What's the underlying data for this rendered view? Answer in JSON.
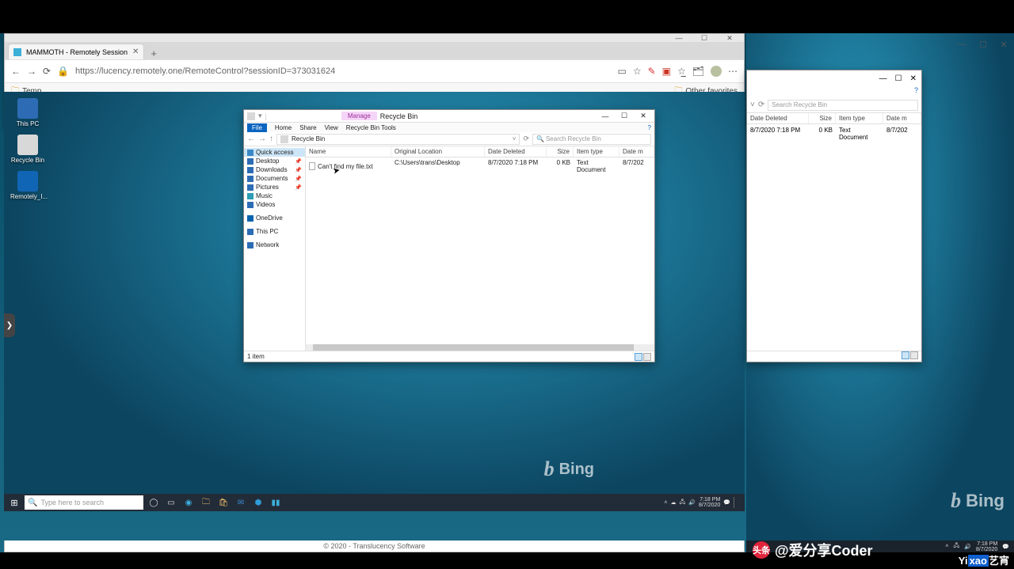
{
  "browser": {
    "tab_title": "MAMMOTH - Remotely Session",
    "url": "https://lucency.remotely.one/RemoteControl?sessionID=373031624",
    "bookmark_left": "Temp",
    "bookmark_right": "Other favorites",
    "footer": "© 2020 - Translucency Software",
    "window_minimize": "—",
    "window_maximize": "☐",
    "window_close": "✕"
  },
  "remote": {
    "desktop_icons": {
      "d1": "This PC",
      "d2": "Recycle Bin",
      "d3": "Remotely_I..."
    },
    "taskbar": {
      "search_placeholder": "Type here to search",
      "time": "7:18 PM",
      "date": "8/7/2020"
    },
    "explorer": {
      "title": "Recycle Bin",
      "ribbon_context": "Manage",
      "ribbon_sub": "Recycle Bin Tools",
      "tabs": {
        "file": "File",
        "home": "Home",
        "share": "Share",
        "view": "View"
      },
      "breadcrumb": "Recycle Bin",
      "search_placeholder": "Search Recycle Bin",
      "sidebar": {
        "quick_access": "Quick access",
        "items": [
          "Desktop",
          "Downloads",
          "Documents",
          "Pictures",
          "Music",
          "Videos"
        ],
        "onedrive": "OneDrive",
        "thispc": "This PC",
        "network": "Network"
      },
      "columns": {
        "name": "Name",
        "ol": "Original Location",
        "dd": "Date Deleted",
        "sz": "Size",
        "it": "Item type",
        "dm": "Date m"
      },
      "rows": [
        {
          "name": "Can't find my file.txt",
          "ol": "C:\\Users\\trans\\Desktop",
          "dd": "8/7/2020 7:18 PM",
          "sz": "0 KB",
          "it": "Text Document",
          "dm": "8/7/202"
        }
      ],
      "status": "1 item"
    }
  },
  "host_explorer": {
    "search_placeholder": "Search Recycle Bin",
    "columns": {
      "dd": "Date Deleted",
      "sz": "Size",
      "it": "Item type",
      "dm": "Date m"
    },
    "row": {
      "dd": "8/7/2020 7:18 PM",
      "sz": "0 KB",
      "it": "Text Document",
      "dm": "8/7/202"
    },
    "window_minimize": "—",
    "window_maximize": "☐",
    "window_close": "✕"
  },
  "host_right": {
    "top_win": {
      "min": "—",
      "max": "☐",
      "close": "✕"
    }
  },
  "host_taskbar": {
    "time": "7:18 PM",
    "date": "8/7/2020"
  },
  "bing": "Bing",
  "watermark": {
    "handle": "@爱分享Coder",
    "yixiao_a": "Yi",
    "yixiao_b": "xao",
    "yixiao_c": "艺宵"
  }
}
